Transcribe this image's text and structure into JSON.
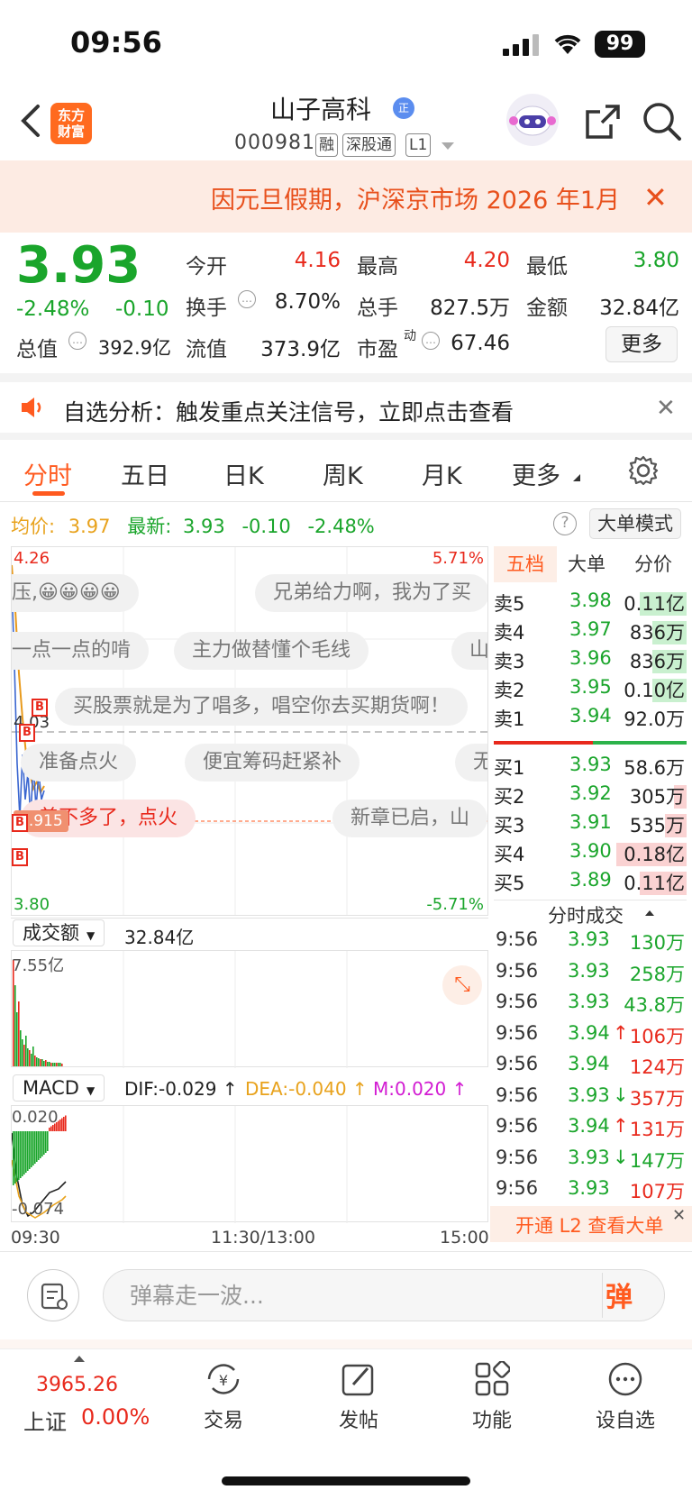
{
  "status": {
    "time": "09:56",
    "battery": "99"
  },
  "header": {
    "logo_line1": "东方",
    "logo_line2": "财富",
    "stock_name": "山子高科",
    "name_badge": "正",
    "stock_code": "000981",
    "tags": [
      "融",
      "深股通",
      "L1"
    ]
  },
  "banner": {
    "text": "因元旦假期，沪深京市场 2026 年1月"
  },
  "quote": {
    "price": "3.93",
    "change_pct": "-2.48%",
    "change": "-0.10",
    "open_label": "今开",
    "open": "4.16",
    "high_label": "最高",
    "high": "4.20",
    "low_label": "最低",
    "low": "3.80",
    "turnover_label": "换手",
    "turnover": "8.70%",
    "volume_label": "总手",
    "volume": "827.5万",
    "amount_label": "金额",
    "amount": "32.84亿",
    "mktcap_label": "总值",
    "mktcap": "392.9亿",
    "float_label": "流值",
    "float": "373.9亿",
    "pe_label": "市盈",
    "pe_sup": "动",
    "pe": "67.46",
    "more_button": "更多"
  },
  "notice": {
    "text": "自选分析：触发重点关注信号，立即点击查看"
  },
  "tabs": [
    "分时",
    "五日",
    "日K",
    "周K",
    "月K",
    "更多"
  ],
  "infoline": {
    "avg_label": "均价:",
    "avg": "3.97",
    "last_label": "最新:",
    "last": "3.93",
    "chg": "-0.10",
    "pct": "-2.48%"
  },
  "big_order_mode": "大单模式",
  "chart": {
    "top_price": "4.26",
    "top_pct": "5.71%",
    "mid_price": "4.03",
    "bottom_price": "3.80",
    "bottom_pct": "-5.71%",
    "marker_price": "3.915",
    "b_marker": "B"
  },
  "danmu": [
    "压,😀😀😀😀",
    "兄弟给力啊，我为了买",
    "一点一点的啃",
    "主力做替懂个毛线",
    "山",
    "买股票就是为了唱多，唱空你去买期货啊！",
    "准备点火",
    "便宜筹码赶紧补",
    "无",
    "差不多了，点火",
    "新章已启，山"
  ],
  "orderbook": {
    "tabs": [
      "五档",
      "大单",
      "分价"
    ],
    "asks": [
      {
        "label": "卖5",
        "price": "3.98",
        "vol": "0.11亿"
      },
      {
        "label": "卖4",
        "price": "3.97",
        "vol": "836万"
      },
      {
        "label": "卖3",
        "price": "3.96",
        "vol": "836万"
      },
      {
        "label": "卖2",
        "price": "3.95",
        "vol": "0.10亿"
      },
      {
        "label": "卖1",
        "price": "3.94",
        "vol": "92.0万"
      }
    ],
    "bids": [
      {
        "label": "买1",
        "price": "3.93",
        "vol": "58.6万"
      },
      {
        "label": "买2",
        "price": "3.92",
        "vol": "305万"
      },
      {
        "label": "买3",
        "price": "3.91",
        "vol": "535万"
      },
      {
        "label": "买4",
        "price": "3.90",
        "vol": "0.18亿"
      },
      {
        "label": "买5",
        "price": "3.89",
        "vol": "0.11亿"
      }
    ]
  },
  "ticks": {
    "title": "分时成交",
    "rows": [
      {
        "time": "9:56",
        "price": "3.93",
        "arrow": "",
        "vol": "130万",
        "dir": "buy"
      },
      {
        "time": "9:56",
        "price": "3.93",
        "arrow": "",
        "vol": "258万",
        "dir": "buy"
      },
      {
        "time": "9:56",
        "price": "3.93",
        "arrow": "",
        "vol": "43.8万",
        "dir": "buy"
      },
      {
        "time": "9:56",
        "price": "3.94",
        "arrow": "↑",
        "vol": "106万",
        "dir": "sell"
      },
      {
        "time": "9:56",
        "price": "3.94",
        "arrow": "",
        "vol": "124万",
        "dir": "sell"
      },
      {
        "time": "9:56",
        "price": "3.93",
        "arrow": "↓",
        "vol": "357万",
        "dir": "sell"
      },
      {
        "time": "9:56",
        "price": "3.94",
        "arrow": "↑",
        "vol": "131万",
        "dir": "sell"
      },
      {
        "time": "9:56",
        "price": "3.93",
        "arrow": "↓",
        "vol": "147万",
        "dir": "buy"
      },
      {
        "time": "9:56",
        "price": "3.93",
        "arrow": "",
        "vol": "107万",
        "dir": "sell"
      }
    ],
    "l2_promo": "开通 L2 查看大单"
  },
  "volume": {
    "selector": "成交额",
    "total": "32.84亿",
    "max": "7.55亿"
  },
  "macd": {
    "selector": "MACD",
    "dif": "DIF:-0.029 ↑",
    "dea": "DEA:-0.040 ↑",
    "m": "M:0.020 ↑",
    "top": "0.020",
    "bottom": "-0.074"
  },
  "time_axis": [
    "09:30",
    "11:30/13:00",
    "15:00"
  ],
  "danmu_input": {
    "placeholder": "弹幕走一波...",
    "send": "弹"
  },
  "bottom": {
    "index_value": "3965.26",
    "index_name": "上证",
    "index_pct": "0.00%",
    "nav": [
      "交易",
      "发帖",
      "功能",
      "设自选"
    ]
  }
}
